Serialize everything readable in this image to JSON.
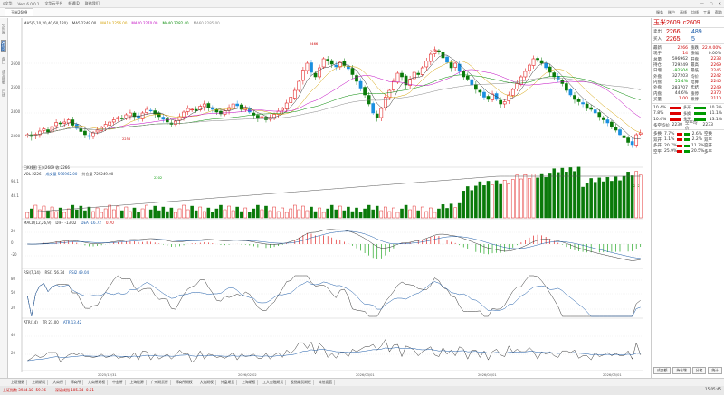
{
  "titlebar": {
    "app": "ɑ文华",
    "items": [
      "Vers 6.0.0.1",
      "文华云平台",
      "帐通ID",
      "联络我们"
    ],
    "controls": [
      "—",
      "▢",
      "✕"
    ]
  },
  "tabs": [
    "玉米2609"
  ],
  "topmenu": [
    "服务",
    "账户",
    "画线",
    "均线",
    "工具",
    "帮助"
  ],
  "leftstrip": [
    "分时图",
    "K线图",
    "盘口",
    "成交明细",
    "日线"
  ],
  "main_legend": {
    "symbol": "MA5(5,10,20,40,60,120)",
    "items": [
      {
        "text": "MA5 2249.00",
        "color": "#333"
      },
      {
        "text": "MA10 2256.00",
        "color": "#d4a000"
      },
      {
        "text": "MA20 2270.00",
        "color": "#c000c0"
      },
      {
        "text": "MA40 2282.40",
        "color": "#008800"
      },
      {
        "text": "MA60 2285.00",
        "color": "#888"
      }
    ]
  },
  "bottom_legend": "日K线图 玉米2609 收:2266",
  "vol_legend": {
    "items": [
      "VOL 2226",
      "成交量 596962.00",
      "持仓量 729249.00"
    ]
  },
  "macd_legend": {
    "items": [
      "MACD(12,26,9)",
      "DIFF -13.02",
      "DEA -16.72",
      "0.70"
    ]
  },
  "rsi_legend": {
    "items": [
      "RSI(7,14)",
      "RSI1 56.34",
      "RSI2 49.04"
    ]
  },
  "atr_legend": {
    "items": [
      "ATR(14)",
      "TR 23.00",
      "ATR 13.42"
    ]
  },
  "price_labels": {
    "high": "2466",
    "high2": "2466",
    "low": "2226",
    "left_mid": "2256",
    "mid_low": "2202"
  },
  "y_axis_main": [
    "2600",
    "2500",
    "2400",
    "2300"
  ],
  "y_axis_vol": [
    "94.1",
    "48.1"
  ],
  "y_axis_macd": [
    "20",
    "0",
    "-20"
  ],
  "y_axis_rsi": [
    "80",
    "50",
    "20"
  ],
  "y_axis_atr": [
    "40",
    "20"
  ],
  "x_axis": [
    "2025/12/31",
    "2026/02/02",
    "2026/03/01",
    "2026/04/01",
    "2026/05/01"
  ],
  "right_panel": {
    "name": "玉米2609",
    "code": "c2609",
    "sell": {
      "label": "卖出",
      "price": "2266",
      "vol": "489"
    },
    "buy": {
      "label": "买入",
      "price": "2265",
      "vol": "5"
    },
    "grid": [
      [
        "最新",
        "2266",
        "涨跌",
        "22.0.00%"
      ],
      [
        "现手",
        "14",
        "涨幅",
        "0.00%"
      ],
      [
        "总量",
        "596962",
        "开盘",
        "2233"
      ],
      [
        "持仓",
        "729249",
        "最高",
        "2269"
      ],
      [
        "日增",
        "-92504",
        "最低",
        "2245"
      ],
      [
        "外盘",
        "327203",
        "均价",
        "2242"
      ],
      [
        "内盘",
        "55.4%",
        "结算",
        "2245"
      ],
      [
        "外盘",
        "283707",
        "昨结",
        "2249"
      ],
      [
        "内盘",
        "44.6%",
        "涨停",
        "2370"
      ],
      [
        "买量",
        "1.00",
        "跌停",
        "2110"
      ]
    ],
    "bars": [
      {
        "left": "10.4%",
        "right": "10.3%",
        "mid": "多开"
      },
      {
        "left": "7.8%",
        "right": "11.1%",
        "mid": "多换"
      },
      {
        "left": "10.4%",
        "right": "13.1%",
        "mid": "多平"
      }
    ],
    "bars_footer": [
      "多空均价",
      "2230",
      "空平均价",
      "2233"
    ],
    "bars2": [
      {
        "k": "多换",
        "l": "7.7%",
        "r": "2.6%",
        "r2": "空换"
      },
      {
        "k": "双开",
        "l": "1.1%",
        "r": "2.2%",
        "r2": "双平"
      },
      {
        "k": "多开",
        "l": "20.7%",
        "r": "11.7%",
        "r2": "空开"
      },
      {
        "k": "空平",
        "l": "25.9%",
        "r": "20.5%",
        "r2": "多平"
      }
    ],
    "buttons": [
      "成交额",
      "持仓增",
      "分笔",
      "统计"
    ]
  },
  "bottomtabs": [
    "上证指数",
    "上期期货",
    "大商所",
    "郑商所",
    "大商所期权",
    "中金所",
    "上海能源",
    "广州期货所",
    "郑商所期权",
    "大连期权",
    "外盘期货",
    "上海期权",
    "工大金融期货",
    "股指期货期权",
    "其他设置"
  ],
  "statusbar": {
    "left1": "上证指数 3944.18 -59.16",
    "left2": "深证成指 105.34 -0.51",
    "right": "15:05:45"
  },
  "chart_data": {
    "type": "candlestick",
    "note_scale": "approximate, read from chart",
    "closes": [
      2262,
      2258,
      2263,
      2270,
      2275,
      2268,
      2280,
      2289,
      2286,
      2290,
      2295,
      2283,
      2276,
      2269,
      2262,
      2258,
      2266,
      2272,
      2278,
      2285,
      2290,
      2295,
      2300,
      2297,
      2306,
      2310,
      2302,
      2298,
      2310,
      2318,
      2315,
      2308,
      2302,
      2296,
      2290,
      2285,
      2292,
      2302,
      2312,
      2320,
      2318,
      2315,
      2325,
      2330,
      2322,
      2318,
      2312,
      2308,
      2315,
      2322,
      2330,
      2326,
      2318,
      2320,
      2312,
      2305,
      2298,
      2302,
      2295,
      2300,
      2307,
      2314,
      2320,
      2332,
      2345,
      2360,
      2380,
      2405,
      2420,
      2400,
      2390,
      2410,
      2430,
      2425,
      2418,
      2412,
      2422,
      2415,
      2408,
      2395,
      2380,
      2365,
      2350,
      2330,
      2310,
      2300,
      2320,
      2345,
      2360,
      2380,
      2398,
      2390,
      2372,
      2385,
      2400,
      2395,
      2410,
      2425,
      2440,
      2450,
      2445,
      2432,
      2422,
      2410,
      2420,
      2402,
      2390,
      2385,
      2372,
      2362,
      2356,
      2345,
      2340,
      2352,
      2340,
      2330,
      2335,
      2350,
      2362,
      2375,
      2390,
      2402,
      2416,
      2430,
      2428,
      2420,
      2410,
      2400,
      2390,
      2385,
      2375,
      2360,
      2350,
      2340,
      2335,
      2330,
      2320,
      2318,
      2310,
      2302,
      2295,
      2288,
      2280,
      2272,
      2262,
      2255,
      2245,
      2240,
      2262,
      2266
    ],
    "ylim": [
      2200,
      2500
    ]
  }
}
